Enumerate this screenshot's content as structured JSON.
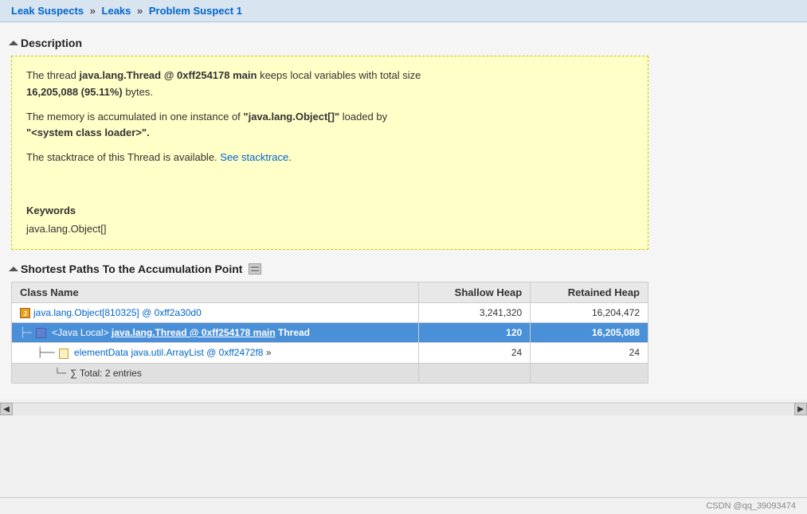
{
  "breadcrumb": {
    "items": [
      {
        "label": "Leak Suspects",
        "href": "#"
      },
      {
        "label": "Leaks",
        "href": "#"
      },
      {
        "label": "Problem Suspect 1",
        "href": "#"
      }
    ],
    "separators": [
      "»",
      "»"
    ]
  },
  "description_section": {
    "title": "Description",
    "paragraph1_pre": "The thread ",
    "paragraph1_bold": "java.lang.Thread @ 0xff254178 main",
    "paragraph1_post": " keeps local variables with total size",
    "paragraph1_bold2": "16,205,088 (95.11%)",
    "paragraph1_post2": " bytes.",
    "paragraph2_pre": "The memory is accumulated in one instance of ",
    "paragraph2_quoted_bold": "\"java.lang.Object[]\"",
    "paragraph2_mid": " loaded by",
    "paragraph2_quoted_bold2": "\"<system class loader>\".",
    "paragraph3_pre": "The stacktrace of this Thread is available. ",
    "paragraph3_link": "See stacktrace",
    "paragraph3_post": ".",
    "keywords_title": "Keywords",
    "keywords_value": "java.lang.Object[]"
  },
  "accumulation_section": {
    "title": "Shortest Paths To the Accumulation Point",
    "table": {
      "columns": [
        {
          "label": "Class Name"
        },
        {
          "label": "Shallow Heap"
        },
        {
          "label": "Retained Heap"
        }
      ],
      "rows": [
        {
          "type": "normal",
          "indent": 0,
          "icon": "file",
          "prefix": "",
          "name_link": "java.lang.Object[810325] @ 0xff2a30d0",
          "shallow": "3,241,320",
          "retained": "16,204,472"
        },
        {
          "type": "highlighted",
          "indent": 1,
          "icon": "thread",
          "prefix": "├─",
          "name_pre": "<Java Local> ",
          "name_link": "java.lang.Thread @ 0xff254178 main",
          "name_post": " Thread",
          "shallow": "120",
          "retained": "16,205,088"
        },
        {
          "type": "normal",
          "indent": 2,
          "icon": "file",
          "prefix": "├──",
          "name_link": "elementData",
          "name_link2": "java.util.ArrayList @ 0xff2472f8",
          "name_post": " »",
          "shallow": "24",
          "retained": "24"
        },
        {
          "type": "total",
          "indent": 3,
          "prefix": "└─",
          "name": "∑ Total: 2 entries",
          "shallow": "",
          "retained": ""
        }
      ]
    }
  },
  "watermark": "CSDN @qq_39093474"
}
